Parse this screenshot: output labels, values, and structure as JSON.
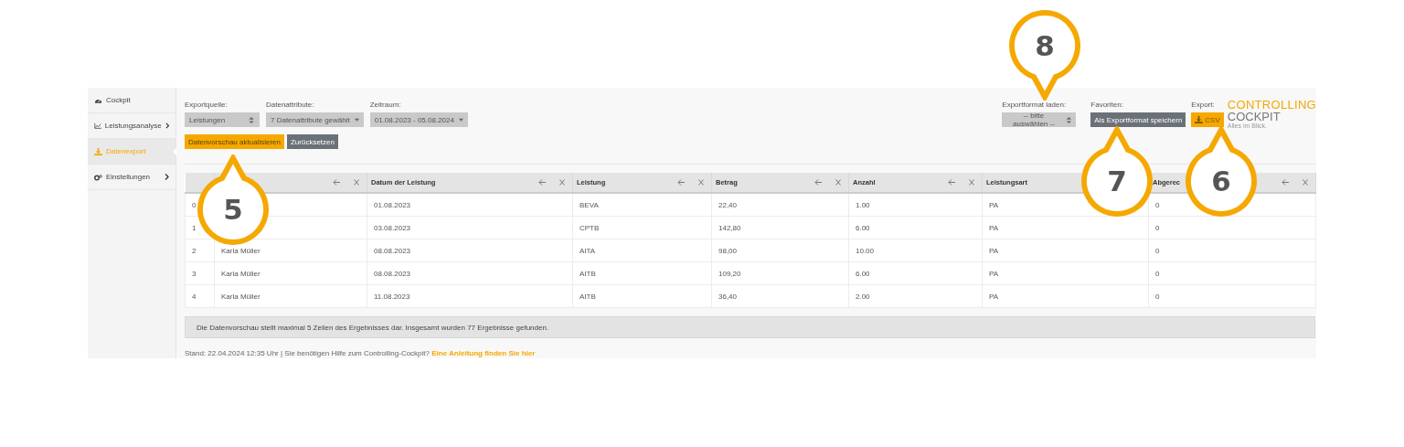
{
  "sidebar": {
    "items": [
      {
        "label": "Cockpit",
        "expandable": false,
        "selected": false
      },
      {
        "label": "Leistungsanalyse",
        "expandable": true,
        "selected": false
      },
      {
        "label": "Datenexport",
        "expandable": false,
        "selected": true
      },
      {
        "label": "Einstellungen",
        "expandable": true,
        "selected": false
      }
    ]
  },
  "filters": [
    {
      "label": "Exportquelle:",
      "value": "Leistungen",
      "kind": "select"
    },
    {
      "label": "Datenattribute:",
      "value": "7 Datenattribute gewählt",
      "kind": "dropdown"
    },
    {
      "label": "Zeitraum:",
      "value": "01.08.2023 - 05.08.2024",
      "kind": "dropdown"
    }
  ],
  "actions": [
    {
      "label": "Datenvorschau aktualisieren",
      "kind": "primary"
    },
    {
      "label": "Zurücksetzen",
      "kind": "secondary"
    }
  ],
  "export_format": {
    "label": "Exportformat laden:",
    "value": "-- bitte auswählen --"
  },
  "favorites": {
    "label": "Favoriten:",
    "button": "Als Exportformat speichern"
  },
  "export": {
    "label": "Export:",
    "button": "CSV"
  },
  "logo": {
    "line_1": "CONTROLLING",
    "line_2": "COCKPIT",
    "tagline": "Alles im Blick."
  },
  "table": {
    "columns": [
      {},
      {
        "label": "Datum der Leistung"
      },
      {
        "label": "Leistung"
      },
      {
        "label": "Betrag"
      },
      {
        "label": "Anzahl"
      },
      {
        "label": "Leistungsart"
      },
      {
        "label": "Abgerec"
      }
    ],
    "rows": [
      {
        "index": "0",
        "cells": [
          "",
          "01.08.2023",
          "BEVA",
          "22,40",
          "1.00",
          "PA",
          "0"
        ]
      },
      {
        "index": "1",
        "cells": [
          "",
          "03.08.2023",
          "CPTB",
          "142,80",
          "6.00",
          "PA",
          "0"
        ]
      },
      {
        "index": "2",
        "cells": [
          "Karla Müller",
          "08.08.2023",
          "AITA",
          "98,00",
          "10.00",
          "PA",
          "0"
        ]
      },
      {
        "index": "3",
        "cells": [
          "Karla Müller",
          "08.08.2023",
          "AITB",
          "109,20",
          "6.00",
          "PA",
          "0"
        ]
      },
      {
        "index": "4",
        "cells": [
          "Karla Müller",
          "11.08.2023",
          "AITB",
          "36,40",
          "2.00",
          "PA",
          "0"
        ]
      }
    ]
  },
  "info": "Die Datenvorschau stellt maximal 5 Zeilen des Ergebnisses dar. Insgesamt wurden 77 Ergebnisse gefunden.",
  "footer": {
    "text": "Stand: 22.04.2024 12:35 Uhr | Sie benötigen Hilfe zum Controlling-Cockpit?",
    "link": "Eine Anleitung finden Sie hier"
  },
  "callouts": [
    {
      "number": "8"
    },
    {
      "number": "7"
    },
    {
      "number": "6"
    },
    {
      "number": "5"
    }
  ]
}
